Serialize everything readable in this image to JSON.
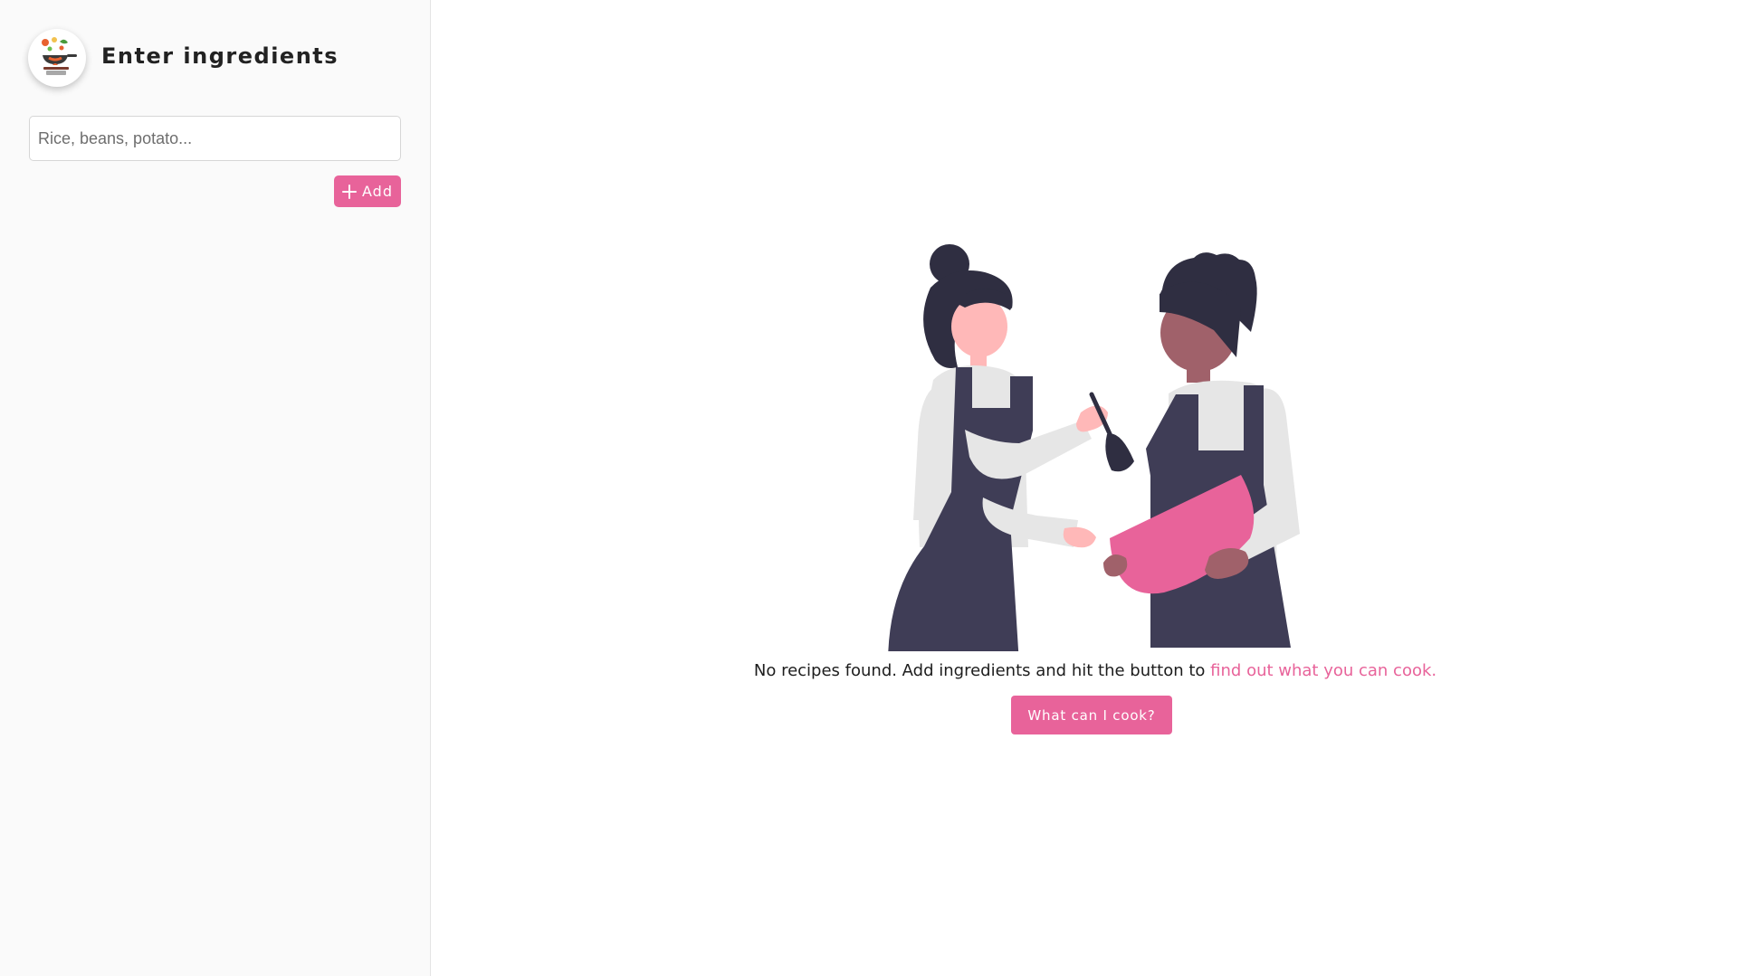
{
  "sidebar": {
    "logo_icon": "cooking-pan-icon",
    "title": "Enter ingredients",
    "input_placeholder": "Rice, beans, potato...",
    "input_value": "",
    "add_button_label": "Add",
    "add_icon": "plus-icon"
  },
  "main": {
    "illustration": "two-chefs-cooking-illustration",
    "empty_message": "No recipes found. Add ingredients and hit the button to",
    "empty_link": "find out what you can cook.",
    "cook_button_label": "What can I cook?"
  },
  "colors": {
    "accent": "#e8639a",
    "sidebar_bg": "#fafafa",
    "main_bg": "#ffffff"
  }
}
